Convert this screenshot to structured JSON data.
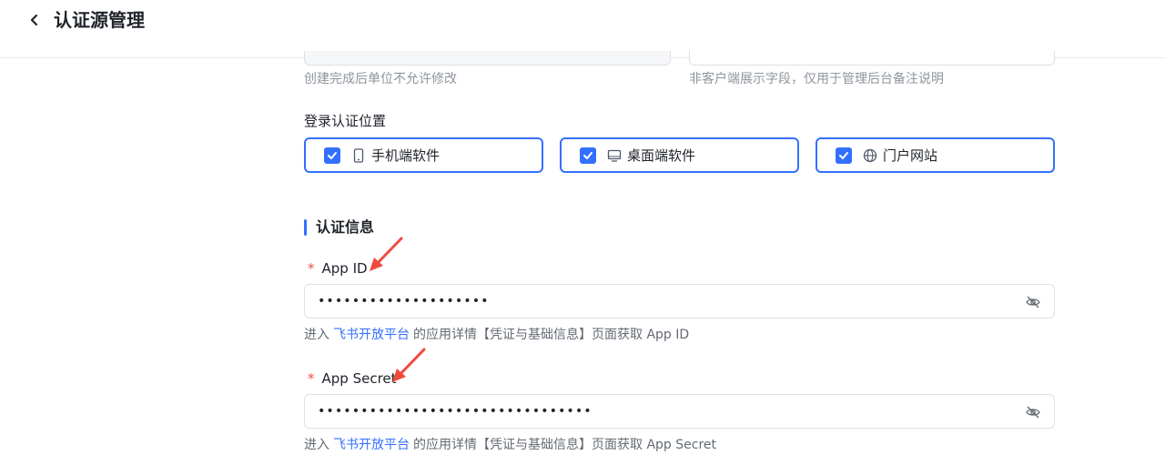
{
  "header": {
    "title": "认证源管理"
  },
  "top_hints": {
    "left": "创建完成后单位不允许修改",
    "right": "非客户端展示字段，仅用于管理后台备注说明"
  },
  "login_position": {
    "label": "登录认证位置",
    "options": [
      {
        "label": "手机端软件",
        "checked": true,
        "icon": "mobile-icon"
      },
      {
        "label": "桌面端软件",
        "checked": true,
        "icon": "desktop-icon"
      },
      {
        "label": "门户网站",
        "checked": true,
        "icon": "globe-icon"
      }
    ]
  },
  "auth_section": {
    "title": "认证信息",
    "app_id": {
      "required_mark": "*",
      "label": "App ID",
      "value": "••••••••••••••••••••",
      "help_prefix": "进入",
      "help_link": "飞书开放平台",
      "help_suffix": "的应用详情【凭证与基础信息】页面获取 App ID"
    },
    "app_secret": {
      "required_mark": "*",
      "label": "App Secret",
      "value": "••••••••••••••••••••••••••••••••",
      "help_prefix": "进入",
      "help_link": "飞书开放平台",
      "help_suffix": "的应用详情【凭证与基础信息】页面获取 App Secret"
    }
  },
  "colors": {
    "accent": "#3370ff",
    "required": "#f54a45",
    "annotation_arrow": "#f04a3e"
  }
}
